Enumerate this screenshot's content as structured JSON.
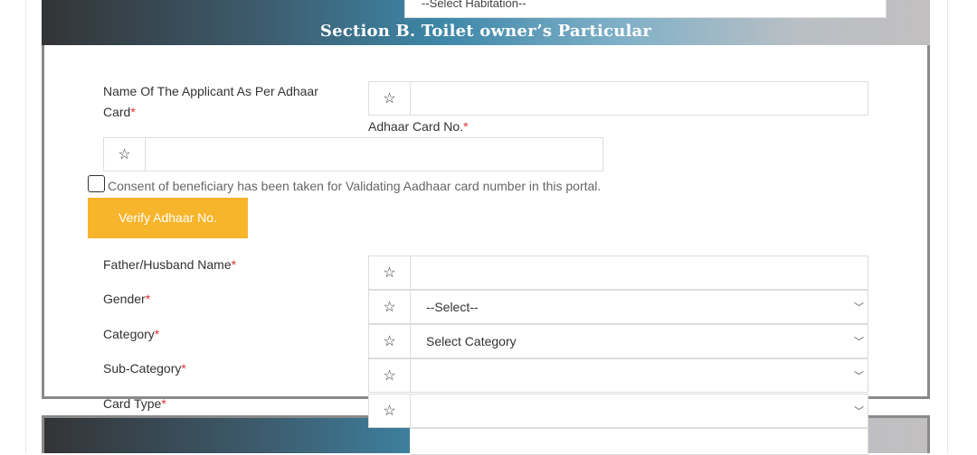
{
  "habitation_select": {
    "value": "--Select Habitation--"
  },
  "section_b": {
    "title": "Section B. Toilet owner’s Particular"
  },
  "fields": {
    "applicant_name": {
      "label": "Name Of The Applicant As Per Adhaar Card",
      "required": "*",
      "value": ""
    },
    "adhaar_no": {
      "label": "Adhaar Card No.",
      "required": "*",
      "value": ""
    },
    "consent": {
      "label": "Consent of beneficiary has been taken for Validating Aadhaar card number in this portal.",
      "checked": false
    },
    "verify_button": "Verify Adhaar No.",
    "father_name": {
      "label": "Father/Husband Name",
      "required": "*",
      "value": ""
    },
    "gender": {
      "label": "Gender",
      "required": "*",
      "value": "--Select--"
    },
    "category": {
      "label": "Category",
      "required": "*",
      "value": "Select Category"
    },
    "sub_category": {
      "label": "Sub-Category",
      "required": "*",
      "value": ""
    },
    "card_type": {
      "label": "Card Type",
      "required": "*",
      "value": ""
    }
  },
  "icons": {
    "field_icon": "star-outline-icon",
    "dropdown": "chevron-down-icon"
  },
  "colors": {
    "verify_button": "#f7b52c",
    "required": "#e03030"
  }
}
